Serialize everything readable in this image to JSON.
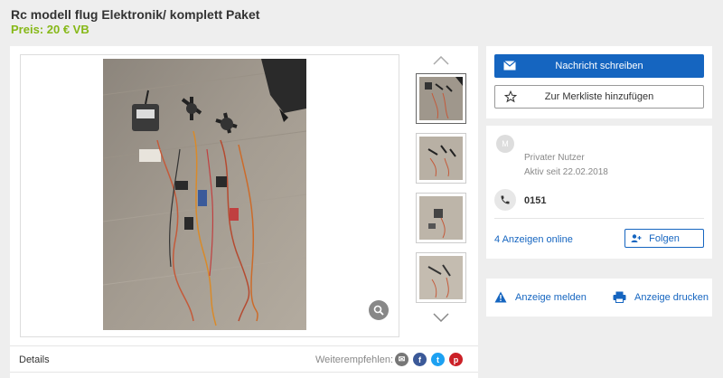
{
  "listing": {
    "title": "Rc modell flug Elektronik/ komplett Paket",
    "price": "Preis: 20 € VB"
  },
  "gallery": {
    "thumbnails": [
      "thumb-1",
      "thumb-2",
      "thumb-3",
      "thumb-4"
    ],
    "active_index": 0
  },
  "details": {
    "label": "Details",
    "share_label": "Weiterempfehlen:"
  },
  "contact": {
    "message_button": "Nachricht schreiben",
    "watchlist_button": "Zur Merkliste hinzufügen"
  },
  "seller": {
    "avatar_letter": "M",
    "type": "Privater Nutzer",
    "active_since": "Aktiv seit 22.02.2018",
    "phone": "0151",
    "ads_online": "4 Anzeigen online",
    "follow_button": "Folgen"
  },
  "actions": {
    "report": "Anzeige melden",
    "print": "Anzeige drucken"
  },
  "colors": {
    "accent": "#1565c0",
    "price": "#86b817",
    "background": "#eeeeee"
  },
  "share_icons": [
    {
      "name": "email-share-icon",
      "glyph": "✉",
      "color": "#777777"
    },
    {
      "name": "facebook-share-icon",
      "glyph": "f",
      "color": "#3b5998"
    },
    {
      "name": "twitter-share-icon",
      "glyph": "t",
      "color": "#1da1f2"
    },
    {
      "name": "pinterest-share-icon",
      "glyph": "p",
      "color": "#cb2027"
    }
  ]
}
